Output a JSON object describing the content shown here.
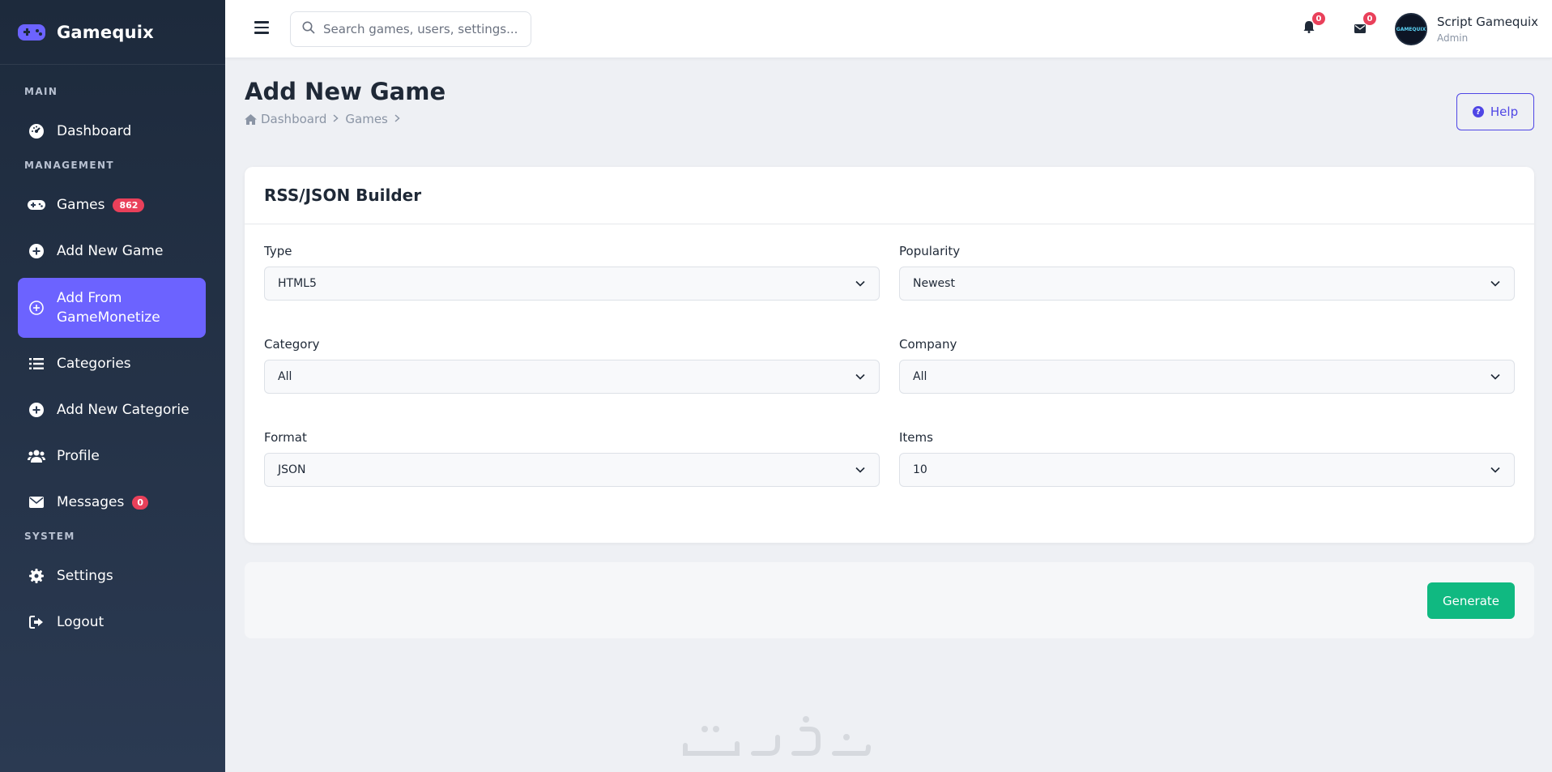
{
  "brand": {
    "name": "Gamequix"
  },
  "sidebar": {
    "sections": {
      "main": "MAIN",
      "management": "MANAGEMENT",
      "system": "SYSTEM"
    },
    "items": [
      {
        "label": "Dashboard",
        "icon": "dashboard-icon"
      },
      {
        "label": "Games",
        "icon": "gamepad-icon",
        "badge": "862"
      },
      {
        "label": "Add New Game",
        "icon": "plus-circle-icon"
      },
      {
        "label": "Add From GameMonetize",
        "icon": "plus-circle-icon",
        "active": true
      },
      {
        "label": "Categories",
        "icon": "list-icon"
      },
      {
        "label": "Add New Categorie",
        "icon": "plus-circle-icon"
      },
      {
        "label": "Profile",
        "icon": "users-icon"
      },
      {
        "label": "Messages",
        "icon": "envelope-icon",
        "badge": "0"
      },
      {
        "label": "Settings",
        "icon": "gear-icon"
      },
      {
        "label": "Logout",
        "icon": "logout-icon"
      }
    ]
  },
  "topbar": {
    "search_placeholder": "Search games, users, settings...",
    "notifications_count": "0",
    "messages_count": "0",
    "user": {
      "name": "Script Gamequix",
      "role": "Admin",
      "avatar_text": "GAMEQUIX"
    }
  },
  "page": {
    "title": "Add New Game",
    "breadcrumb": [
      "Dashboard",
      "Games"
    ],
    "help_label": "Help"
  },
  "card": {
    "title": "RSS/JSON Builder",
    "fields": {
      "type": {
        "label": "Type",
        "value": "HTML5"
      },
      "popularity": {
        "label": "Popularity",
        "value": "Newest"
      },
      "category": {
        "label": "Category",
        "value": "All"
      },
      "company": {
        "label": "Company",
        "value": "All"
      },
      "format": {
        "label": "Format",
        "value": "JSON"
      },
      "items": {
        "label": "Items",
        "value": "10"
      }
    }
  },
  "actions": {
    "generate_label": "Generate"
  },
  "colors": {
    "accent": "#6c63ff",
    "sidebar": "#1d2a3c",
    "badge": "#e9405a",
    "success": "#10b981",
    "help": "#4f46e5"
  }
}
